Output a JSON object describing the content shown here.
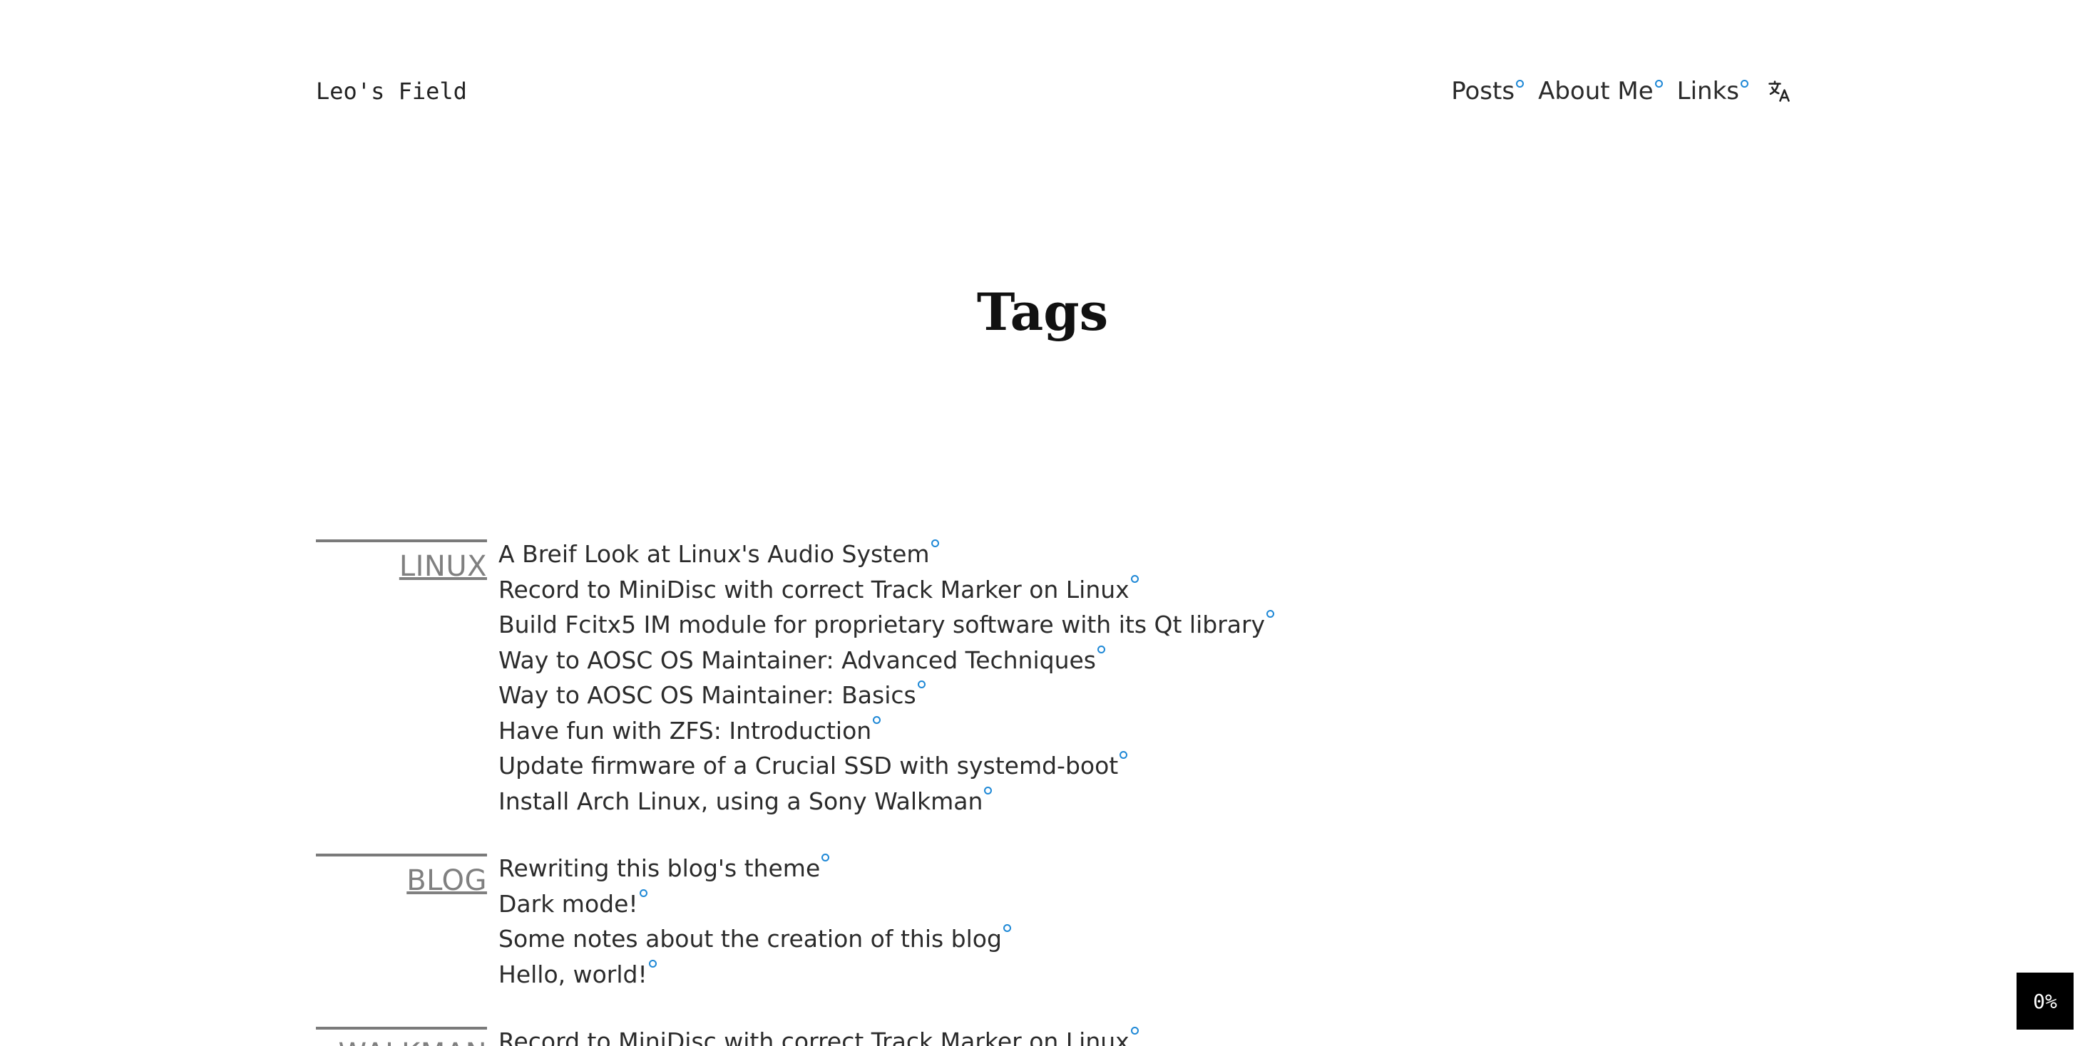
{
  "header": {
    "site_title": "Leo's Field",
    "nav": [
      {
        "label": "Posts"
      },
      {
        "label": "About Me"
      },
      {
        "label": "Links"
      }
    ],
    "language_icon": "translate-icon"
  },
  "page": {
    "title": "Tags"
  },
  "tags": [
    {
      "name": "LINUX",
      "posts": [
        "A Breif Look at Linux's Audio System",
        "Record to MiniDisc with correct Track Marker on Linux",
        "Build Fcitx5 IM module for proprietary software with its Qt library",
        "Way to AOSC OS Maintainer: Advanced Techniques",
        "Way to AOSC OS Maintainer: Basics",
        "Have fun with ZFS: Introduction",
        "Update firmware of a Crucial SSD with systemd-boot",
        "Install Arch Linux, using a Sony Walkman"
      ]
    },
    {
      "name": "BLOG",
      "posts": [
        "Rewriting this blog's theme",
        "Dark mode!",
        "Some notes about the creation of this blog",
        "Hello, world!"
      ]
    },
    {
      "name": "WALKMAN",
      "posts": [
        "Record to MiniDisc with correct Track Marker on Linux"
      ]
    }
  ],
  "reading_progress": "0%",
  "colors": {
    "link_ring": "#1e88d6",
    "tag_rule": "#7a7a7a",
    "tag_label": "#808080",
    "badge_bg": "#000000"
  }
}
